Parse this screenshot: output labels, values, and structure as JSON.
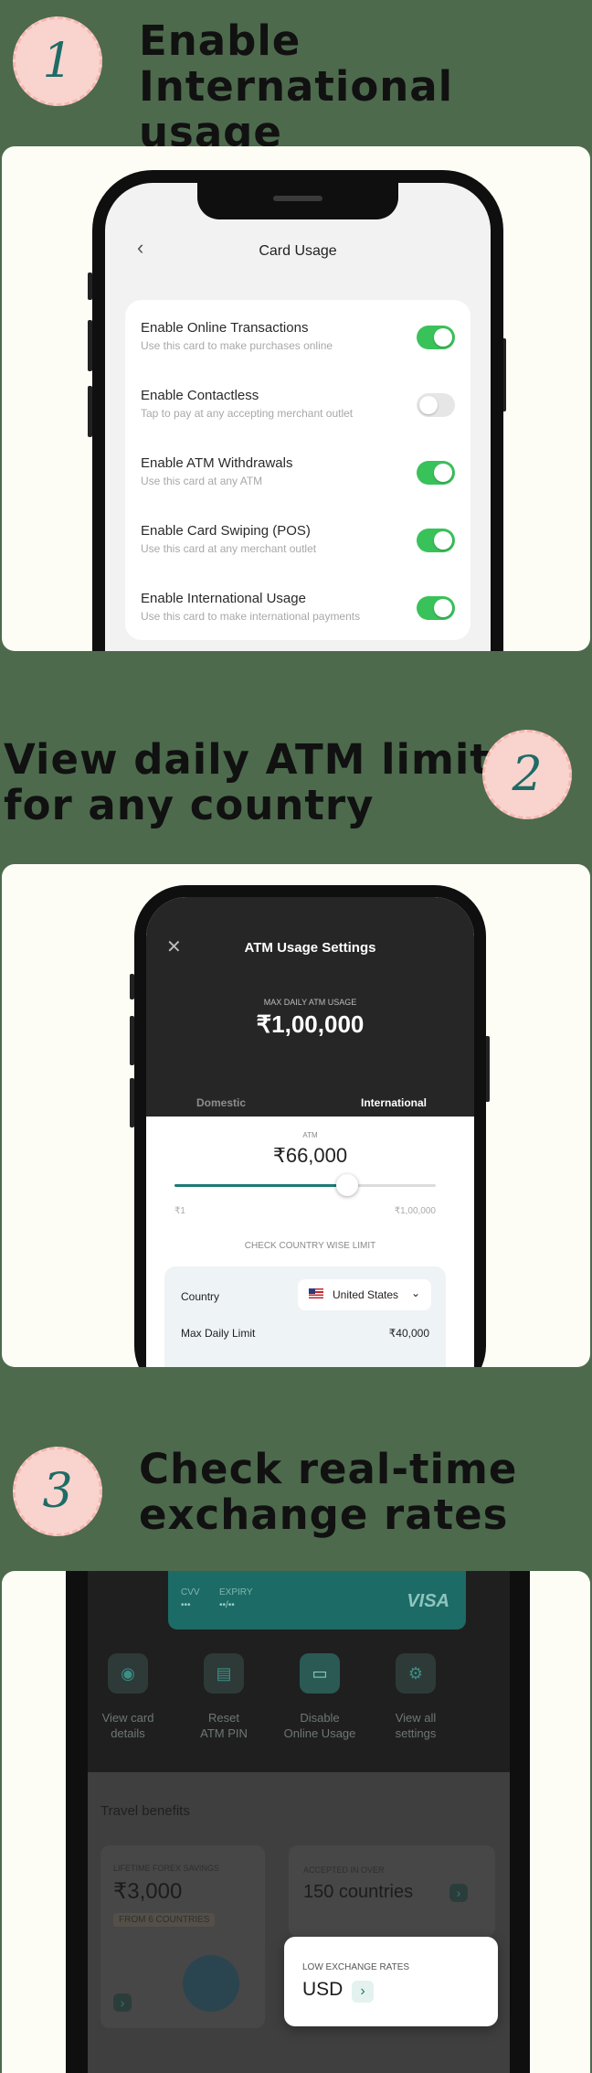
{
  "sections": [
    {
      "number": "1",
      "heading_line1": "Enable International",
      "heading_line2": "usage"
    },
    {
      "number": "2",
      "heading_line1": "View daily ATM limits",
      "heading_line2": "for any country"
    },
    {
      "number": "3",
      "heading_line1": "Check real-time",
      "heading_line2": "exchange rates"
    }
  ],
  "card_usage": {
    "title": "Card Usage",
    "rows": [
      {
        "title": "Enable Online Transactions",
        "subtitle": "Use this card to make purchases online",
        "enabled": true
      },
      {
        "title": "Enable Contactless",
        "subtitle": "Tap to pay at any accepting merchant outlet",
        "enabled": false
      },
      {
        "title": "Enable ATM Withdrawals",
        "subtitle": "Use this card at any ATM",
        "enabled": true
      },
      {
        "title": "Enable Card Swiping (POS)",
        "subtitle": "Use this card at any merchant outlet",
        "enabled": true
      },
      {
        "title": "Enable International Usage",
        "subtitle": "Use this card to make international payments",
        "enabled": true
      }
    ]
  },
  "atm_settings": {
    "title": "ATM Usage Settings",
    "max_label": "MAX DAILY ATM USAGE",
    "max_value": "₹1,00,000",
    "tab_domestic": "Domestic",
    "tab_international": "International",
    "atm_label": "ATM",
    "atm_value": "₹66,000",
    "slider_fraction": 0.66,
    "slider_min": "₹1",
    "slider_max": "₹1,00,000",
    "check_label": "CHECK COUNTRY WISE LIMIT",
    "country_label": "Country",
    "country_value": "United States",
    "limit_label": "Max Daily Limit",
    "limit_value": "₹40,000"
  },
  "card_screen": {
    "cvv_label": "CVV",
    "cvv_value": "•••",
    "expiry_label": "EXPIRY",
    "expiry_value": "••/••",
    "brand": "VISA",
    "actions": [
      {
        "icon": "eye-icon",
        "line1": "View card",
        "line2": "details"
      },
      {
        "icon": "card-icon",
        "line1": "Reset",
        "line2": "ATM PIN"
      },
      {
        "icon": "laptop-icon",
        "line1": "Disable",
        "line2": "Online Usage"
      },
      {
        "icon": "gear-icon",
        "line1": "View all",
        "line2": "settings"
      }
    ],
    "travel_title": "Travel benefits",
    "savings_label": "LIFETIME FOREX SAVINGS",
    "savings_value": "₹3,000",
    "savings_sub": "FROM 6 COUNTRIES",
    "accepted_label": "ACCEPTED IN OVER",
    "accepted_value": "150 countries",
    "rates_label": "LOW EXCHANGE RATES",
    "rates_value": "USD"
  },
  "colors": {
    "background": "#4d6a4d",
    "toggle_on": "#3ac25a",
    "toggle_off": "#e6e6e6",
    "teal": "#1e7a74",
    "badge": "#f9d4cf"
  }
}
